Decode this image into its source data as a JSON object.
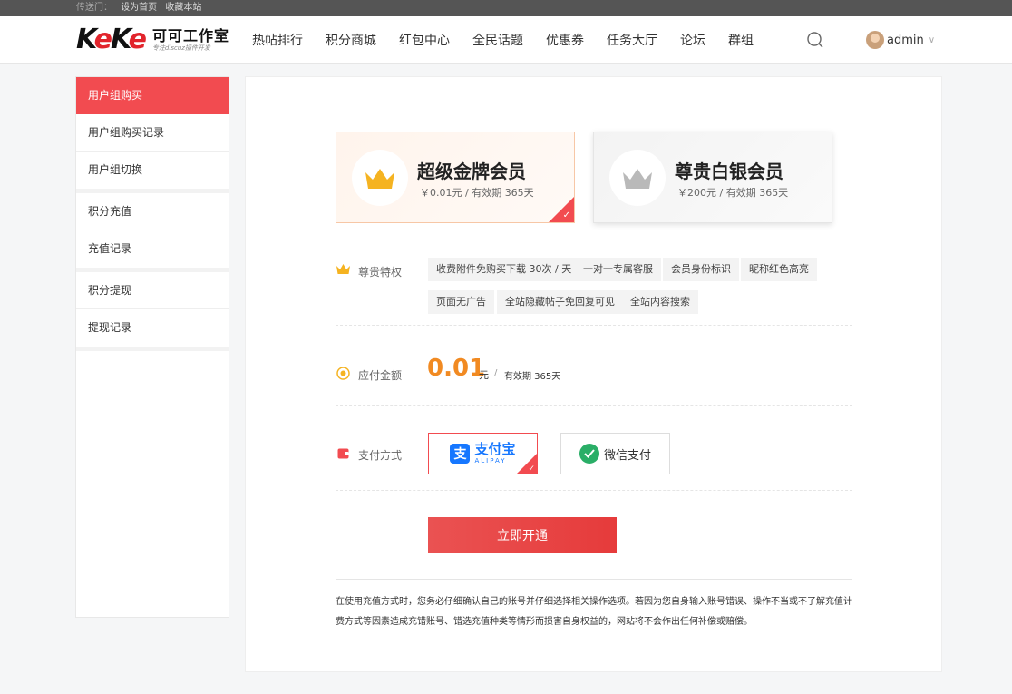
{
  "topbar": {
    "lead": "传送门：",
    "links": [
      "设为首页",
      "收藏本站"
    ]
  },
  "header": {
    "logo_mark": "KeKe",
    "logo_cn": "可可工作室",
    "logo_sub": "专注discuz插件开发",
    "nav": [
      "热帖排行",
      "积分商城",
      "红包中心",
      "全民话题",
      "优惠券",
      "任务大厅",
      "论坛",
      "群组"
    ],
    "username": "admin",
    "caret": "∨"
  },
  "sidebar": {
    "groups": [
      [
        "用户组购买",
        "用户组购买记录",
        "用户组切换"
      ],
      [
        "积分充值",
        "充值记录"
      ],
      [
        "积分提现",
        "提现记录"
      ]
    ],
    "active": "用户组购买"
  },
  "plans": [
    {
      "title": "超级金牌会员",
      "price": "￥0.01元 / 有效期 365天",
      "selected": true,
      "crown_color": "#f5b321"
    },
    {
      "title": "尊贵白银会员",
      "price": "￥200元 / 有效期 365天",
      "selected": false,
      "crown_color": "#b9b9b9"
    }
  ],
  "privileges": {
    "label": "尊贵特权",
    "tags": [
      "收费附件免购买下载 30次 / 天",
      "一对一专属客服",
      "会员身份标识",
      "昵称红色高亮",
      "页面无广告",
      "全站隐藏帖子免回复可见",
      "全站内容搜索"
    ]
  },
  "payment_amount": {
    "label": "应付金额",
    "value": "0.01",
    "unit": "元",
    "sep": "/",
    "validity": "有效期 365天"
  },
  "payment_method": {
    "label": "支付方式",
    "alipay_cn": "支付宝",
    "alipay_en": "ALIPAY",
    "alipay_glyph": "支",
    "wechat_label": "微信支付",
    "selected": "alipay"
  },
  "submit_label": "立即开通",
  "notice": "在使用充值方式时，您务必仔细确认自己的账号并仔细选择相关操作选项。若因为您自身输入账号错误、操作不当或不了解充值计费方式等因素造成充错账号、错选充值种类等情形而损害自身权益的，网站将不会作出任何补偿或赔偿。",
  "colors": {
    "accent": "#f24b50",
    "amount": "#f18a22",
    "alipay": "#1677ff",
    "wechat": "#2aae67"
  }
}
